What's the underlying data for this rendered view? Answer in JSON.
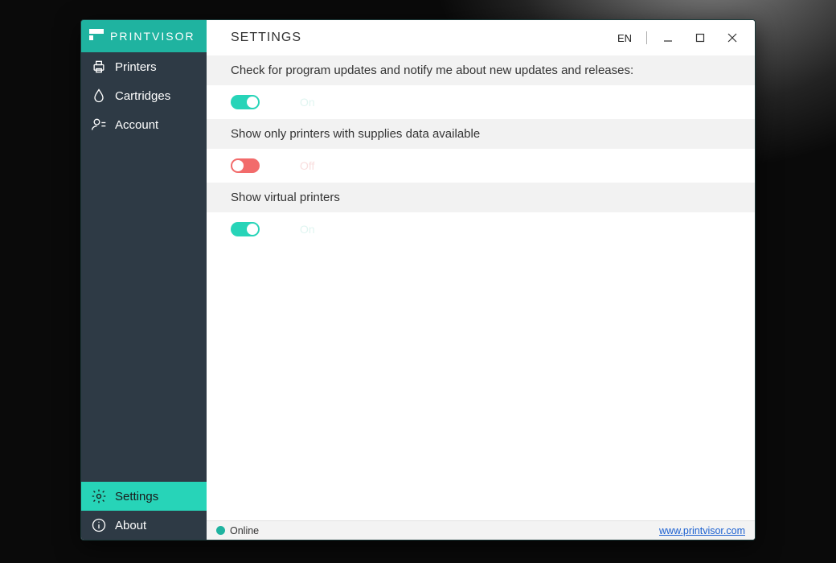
{
  "app": {
    "brand": "PRINTVISOR"
  },
  "sidebar": {
    "items": [
      {
        "label": "Printers"
      },
      {
        "label": "Cartridges"
      },
      {
        "label": "Account"
      }
    ],
    "bottom": [
      {
        "label": "Settings"
      },
      {
        "label": "About"
      }
    ]
  },
  "header": {
    "title": "SETTINGS",
    "lang": "EN"
  },
  "settings": [
    {
      "label": "Check for program updates and notify me about new updates and releases:",
      "state": "On",
      "on": true
    },
    {
      "label": "Show only printers with supplies data available",
      "state": "Off",
      "on": false
    },
    {
      "label": "Show virtual printers",
      "state": "On",
      "on": true
    }
  ],
  "status": {
    "text": "Online",
    "link": "www.printvisor.com"
  }
}
